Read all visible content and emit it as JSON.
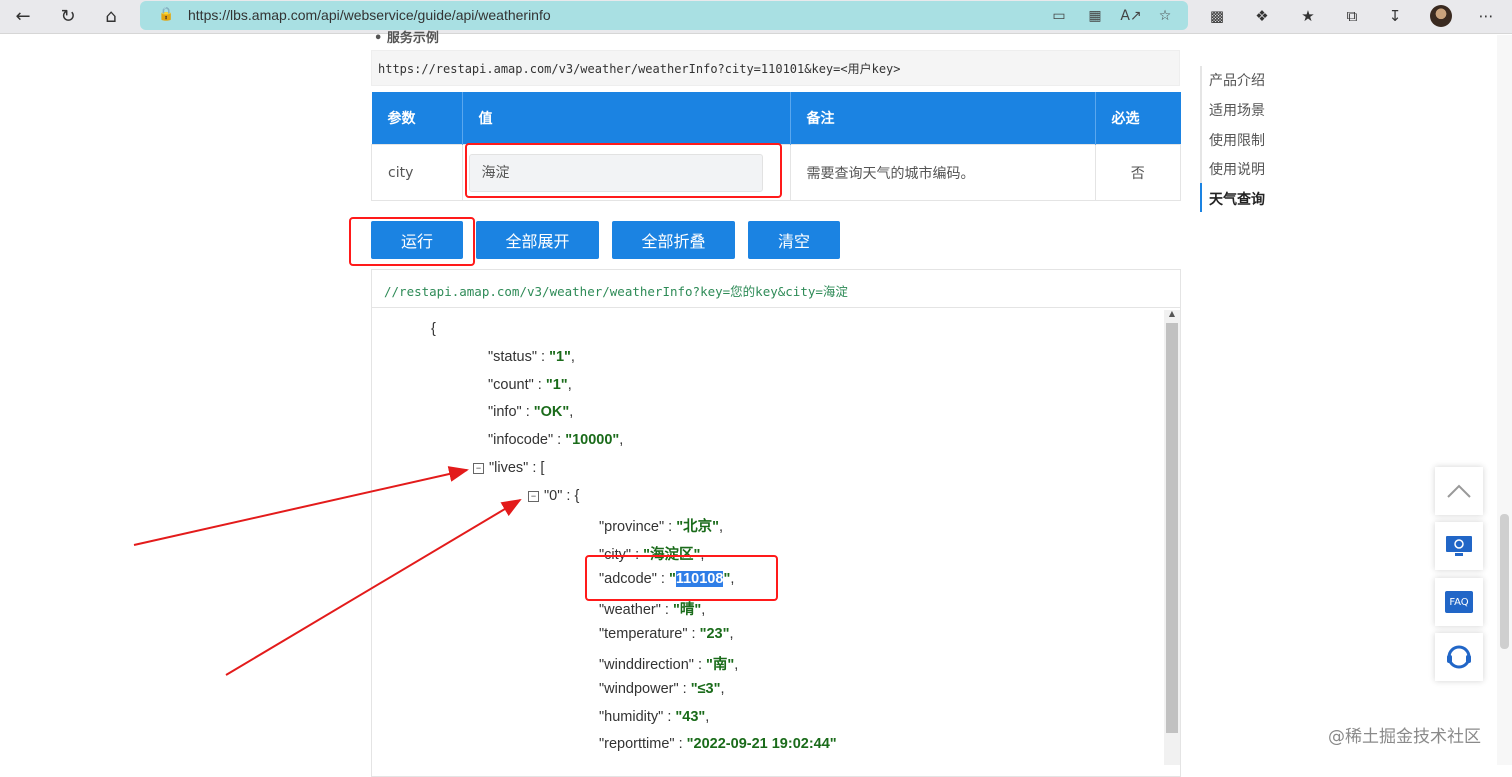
{
  "browser": {
    "url": "https://lbs.amap.com/api/webservice/guide/api/weatherinfo"
  },
  "example": {
    "label": "服务示例",
    "request_url": "https://restapi.amap.com/v3/weather/weatherInfo?city=110101&key=<用户key>"
  },
  "params_table": {
    "headers": [
      "参数",
      "值",
      "备注",
      "必选"
    ],
    "row": {
      "param": "city",
      "value": "海淀",
      "note": "需要查询天气的城市编码。",
      "required": "否"
    }
  },
  "buttons": {
    "run": "运行",
    "expand_all": "全部展开",
    "collapse_all": "全部折叠",
    "clear": "清空"
  },
  "response": {
    "url": "//restapi.amap.com/v3/weather/weatherInfo?key=您的key&city=海淀",
    "open_brace": "{",
    "fields": [
      {
        "key": "\"status\"",
        "value": "\"1\""
      },
      {
        "key": "\"count\"",
        "value": "\"1\""
      },
      {
        "key": "\"info\"",
        "value": "\"OK\""
      },
      {
        "key": "\"infocode\"",
        "value": "\"10000\""
      }
    ],
    "lives_key": "\"lives\"",
    "lives_open": "[",
    "item_key": "\"0\"",
    "item_open": "{",
    "item_fields": [
      {
        "key": "\"province\"",
        "value": "\"北京\""
      },
      {
        "key": "\"city\"",
        "value": "\"海淀区\""
      },
      {
        "key": "\"adcode\"",
        "value": "110108"
      },
      {
        "key": "\"weather\"",
        "value": "\"晴\""
      },
      {
        "key": "\"temperature\"",
        "value": "\"23\""
      },
      {
        "key": "\"winddirection\"",
        "value": "\"南\""
      },
      {
        "key": "\"windpower\"",
        "value": "\"≤3\""
      },
      {
        "key": "\"humidity\"",
        "value": "\"43\""
      },
      {
        "key": "\"reporttime\"",
        "value": "\"2022-09-21 19:02:44\""
      }
    ]
  },
  "toc": {
    "items": [
      "产品介绍",
      "适用场景",
      "使用限制",
      "使用说明",
      "天气查询"
    ],
    "active": "天气查询"
  },
  "floating": {
    "faq_label": "FAQ"
  },
  "watermark": "@稀土掘金技术社区",
  "colors": {
    "primary": "#1b83e2",
    "address_bar": "#a9e0e3",
    "json_value": "#1a6b1a",
    "annotation_red": "#ff1a1a"
  }
}
